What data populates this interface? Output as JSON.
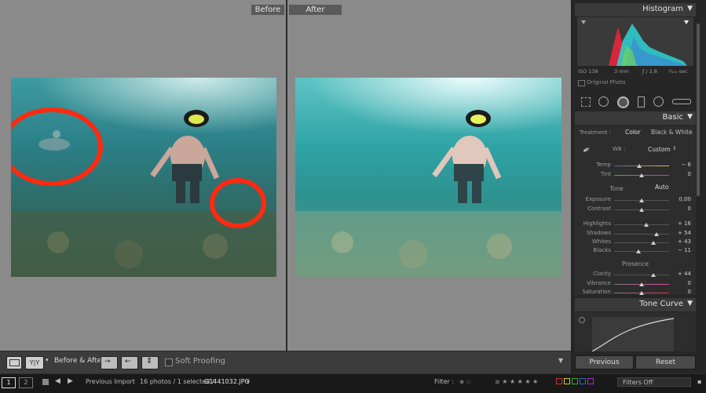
{
  "panes": {
    "before_label": "Before",
    "after_label": "After"
  },
  "toolbar": {
    "view_mode_glyph": "Y|Y",
    "before_after_label": "Before & After :",
    "soft_proofing_label": "Soft Proofing"
  },
  "filmstrip": {
    "page1": "1",
    "page2": "2",
    "source": "Previous Import",
    "count": "16 photos / 1 selected /",
    "filename": "G1441032.JPG",
    "filter_label": "Filter :",
    "filter_value": "Filters Off"
  },
  "histogram": {
    "title": "Histogram",
    "iso": "ISO 138",
    "focal": "3 mm",
    "aperture": "ƒ / 2,8",
    "shutter": "¹⁄₁₀₀ sec",
    "original_photo": "Original Photo"
  },
  "basic": {
    "title": "Basic",
    "treatment_label": "Treatment :",
    "treatment_color": "Color",
    "treatment_bw": "Black & White",
    "wb_label": "WB :",
    "wb_value": "Custom",
    "tone_label": "Tone",
    "auto_label": "Auto",
    "presence_label": "Presence",
    "sliders": [
      {
        "label": "Temp",
        "value": "− 6",
        "pos": 0.45
      },
      {
        "label": "Tint",
        "value": "0",
        "pos": 0.5
      },
      {
        "label": "Exposure",
        "value": "0,00",
        "pos": 0.5
      },
      {
        "label": "Contrast",
        "value": "0",
        "pos": 0.5
      },
      {
        "label": "Highlights",
        "value": "+ 16",
        "pos": 0.58
      },
      {
        "label": "Shadows",
        "value": "+ 54",
        "pos": 0.77
      },
      {
        "label": "Whites",
        "value": "+ 43",
        "pos": 0.71
      },
      {
        "label": "Blacks",
        "value": "− 11",
        "pos": 0.44
      },
      {
        "label": "Clarity",
        "value": "+ 44",
        "pos": 0.72
      },
      {
        "label": "Vibrance",
        "value": "0",
        "pos": 0.5
      },
      {
        "label": "Saturation",
        "value": "0",
        "pos": 0.5
      }
    ]
  },
  "tone_curve": {
    "title": "Tone Curve"
  },
  "actions": {
    "previous": "Previous",
    "reset": "Reset"
  },
  "colors": {
    "workspace": "#8a8a8a",
    "panel": "#262626",
    "annotation": "#ff2a10"
  }
}
